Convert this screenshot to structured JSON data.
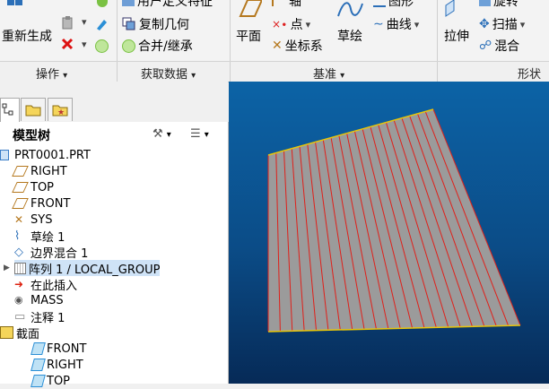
{
  "ribbon": {
    "regenerate_label": "重新生成",
    "user_defined_feature": "用户定义特征",
    "copy_geometry": "复制几何",
    "merge_inherit": "合并/继承",
    "plane": "平面",
    "axis": "轴",
    "point": "点",
    "coordinate_system": "坐标系",
    "sketch": "草绘",
    "graph": "图形",
    "curve": "曲线",
    "extrude": "拉伸",
    "revolve": "旋转",
    "sweep": "扫描",
    "blend": "混合"
  },
  "groups": {
    "operations": "操作",
    "get_data": "获取数据",
    "datum": "基准",
    "shapes": "形状",
    "dropdown_glyph": "▾"
  },
  "tree": {
    "title": "模型树",
    "items": [
      {
        "label": "PRT0001.PRT",
        "icon": "part-icon"
      },
      {
        "label": "RIGHT",
        "icon": "datum-plane-icon"
      },
      {
        "label": "TOP",
        "icon": "datum-plane-icon"
      },
      {
        "label": "FRONT",
        "icon": "datum-plane-icon"
      },
      {
        "label": "SYS",
        "icon": "coordinate-system-icon"
      },
      {
        "label": "草绘 1",
        "icon": "sketch-icon"
      },
      {
        "label": "边界混合 1",
        "icon": "boundary-blend-icon"
      },
      {
        "label": "阵列 1 / LOCAL_GROUP",
        "icon": "pattern-icon",
        "selected": true
      },
      {
        "label": "在此插入",
        "icon": "insert-here-arrow-icon"
      },
      {
        "label": "MASS",
        "icon": "mass-icon"
      },
      {
        "label": "注释 1",
        "icon": "annotation-icon"
      },
      {
        "label": "截面",
        "icon": "section-folder-icon"
      },
      {
        "label": "FRONT",
        "icon": "section-plane-icon"
      },
      {
        "label": "RIGHT",
        "icon": "section-plane-icon"
      },
      {
        "label": "TOP",
        "icon": "section-plane-icon"
      }
    ]
  },
  "colors": {
    "viewport_top": "#0c63a6",
    "viewport_bottom": "#062a57",
    "surface": "#9b9b9b",
    "edge_red": "#e0201a",
    "edge_yellow": "#e8c60a",
    "selection": "#cfe3f7"
  }
}
